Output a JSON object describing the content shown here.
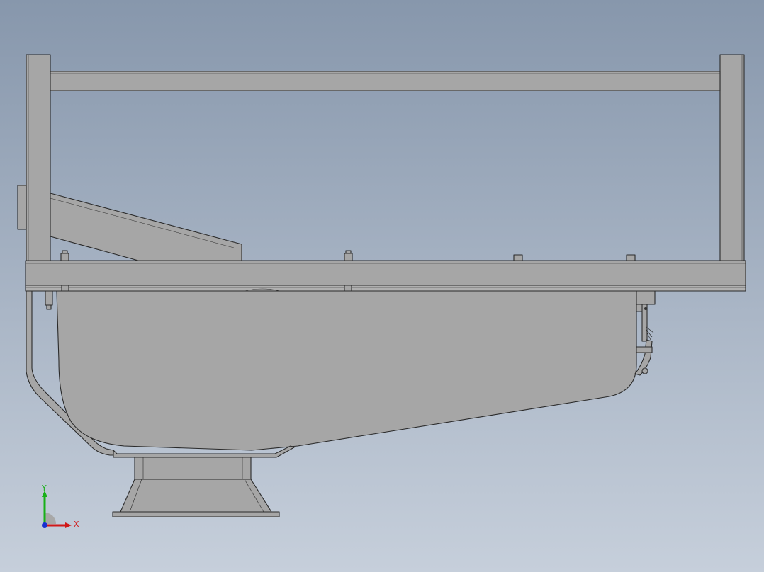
{
  "view": {
    "background_top": "#8797ac",
    "background_bottom": "#c6cfdb",
    "part_fill": "#a6a6a6",
    "edge_color": "#2a2a2a"
  },
  "triad": {
    "x_label": "X",
    "y_label": "Y",
    "x_color": "#d01818",
    "y_color": "#18b018",
    "z_color": "#1830d0"
  }
}
